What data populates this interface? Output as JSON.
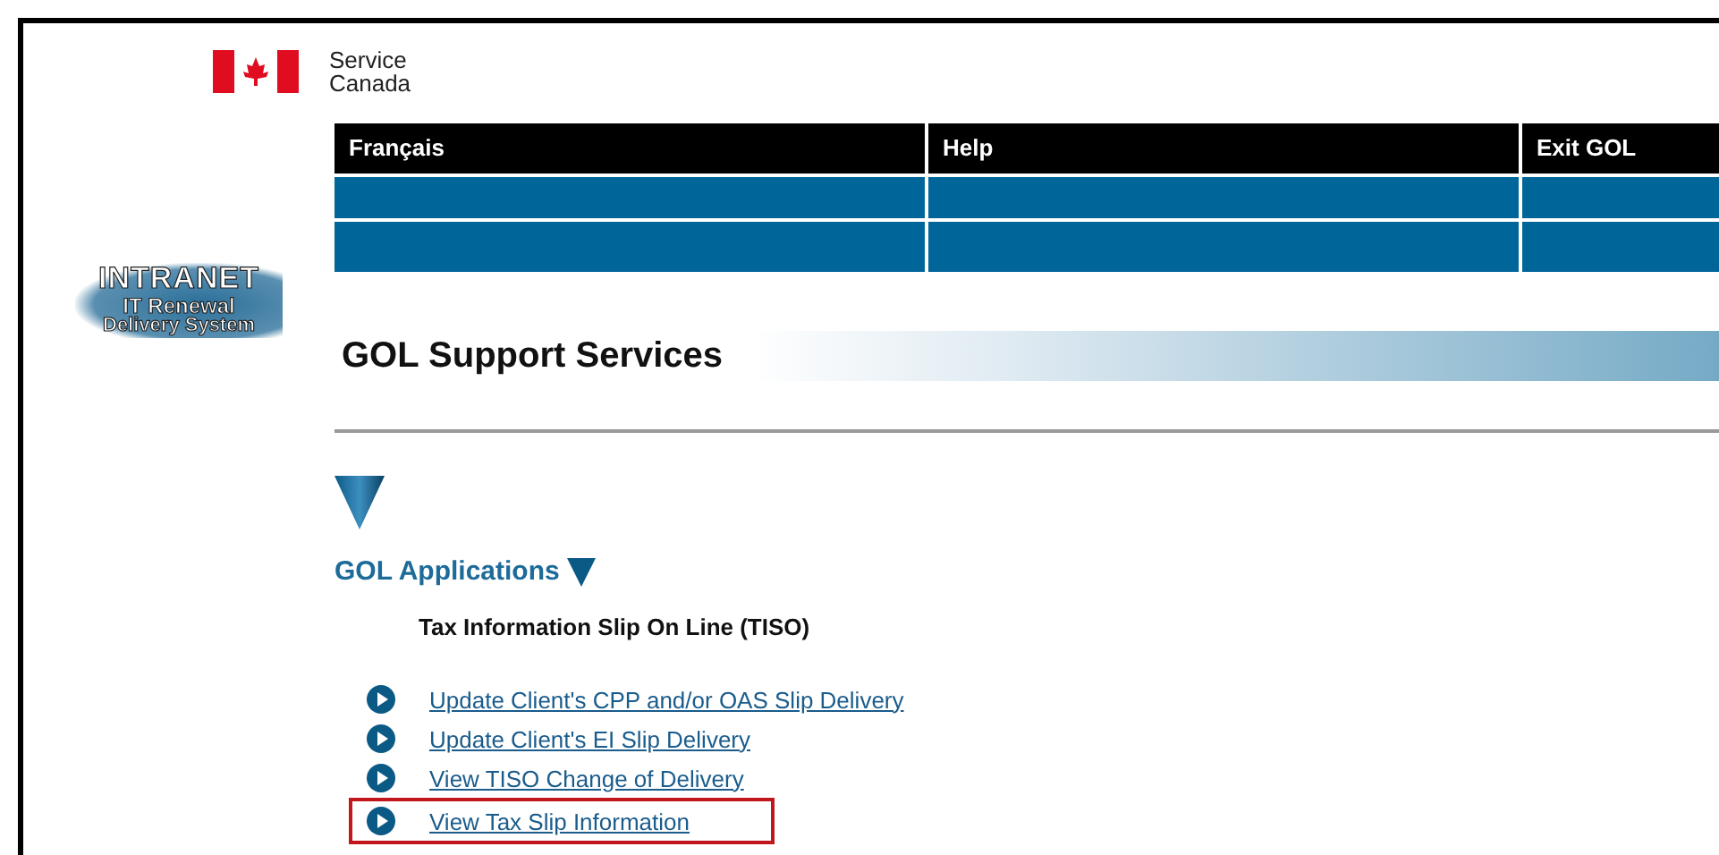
{
  "header": {
    "brand_line_1": "Service",
    "brand_line_2": "Canada"
  },
  "nav": {
    "top": [
      {
        "label": "Français"
      },
      {
        "label": "Help"
      },
      {
        "label": "Exit GOL"
      }
    ]
  },
  "intranet_logo": {
    "line_1": "INTRANET",
    "line_2": "IT Renewal",
    "line_3": "Delivery System"
  },
  "page_title": "GOL Support Services",
  "section": {
    "title": "GOL Applications",
    "subtitle": "Tax Information Slip On Line (TISO)",
    "links": [
      {
        "label": "Update Client's CPP and/or OAS Slip Delivery",
        "highlighted": false
      },
      {
        "label": "Update Client's EI Slip Delivery",
        "highlighted": false
      },
      {
        "label": "View TISO Change of Delivery",
        "highlighted": false
      },
      {
        "label": "View Tax Slip Information",
        "highlighted": true
      }
    ]
  }
}
